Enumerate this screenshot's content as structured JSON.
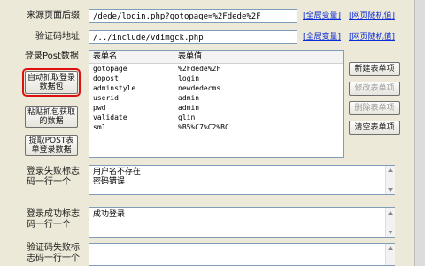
{
  "form": {
    "referer_label": "来源页面后缀",
    "referer_value": "/dede/login.php?gotopage=%2Fdede%2F",
    "captcha_label": "验证码地址",
    "captcha_value": "/../include/vdimgck.php",
    "global_var_link": "[全局变量]",
    "random_link": "[网页随机值]",
    "post_label": "登录Post数据",
    "fail_label": "登录失败标志码一行一个",
    "fail_text": "用户名不存在\n密码错误",
    "success_label": "登录成功标志码一行一个",
    "success_text": "成功登录",
    "captcha_fail_label": "验证码失败标志码一行一个"
  },
  "buttons": {
    "auto_capture": "自动抓取登录数据包",
    "paste_capture": "粘贴抓包获取的数据",
    "extract_post": "提取POST表单登录数据",
    "new_item": "新建表单项",
    "edit_item": "修改表单项",
    "delete_item": "删除表单项",
    "clear_items": "清空表单项"
  },
  "table": {
    "headers": [
      "表单名",
      "表单值"
    ],
    "rows": [
      [
        "gotopage",
        "%2Fdede%2F"
      ],
      [
        "dopost",
        "login"
      ],
      [
        "adminstyle",
        "newdedecms"
      ],
      [
        "userid",
        "admin"
      ],
      [
        "pwd",
        "admin"
      ],
      [
        "validate",
        "glin"
      ],
      [
        "sm1",
        "%B5%C7%C2%BC"
      ]
    ]
  }
}
